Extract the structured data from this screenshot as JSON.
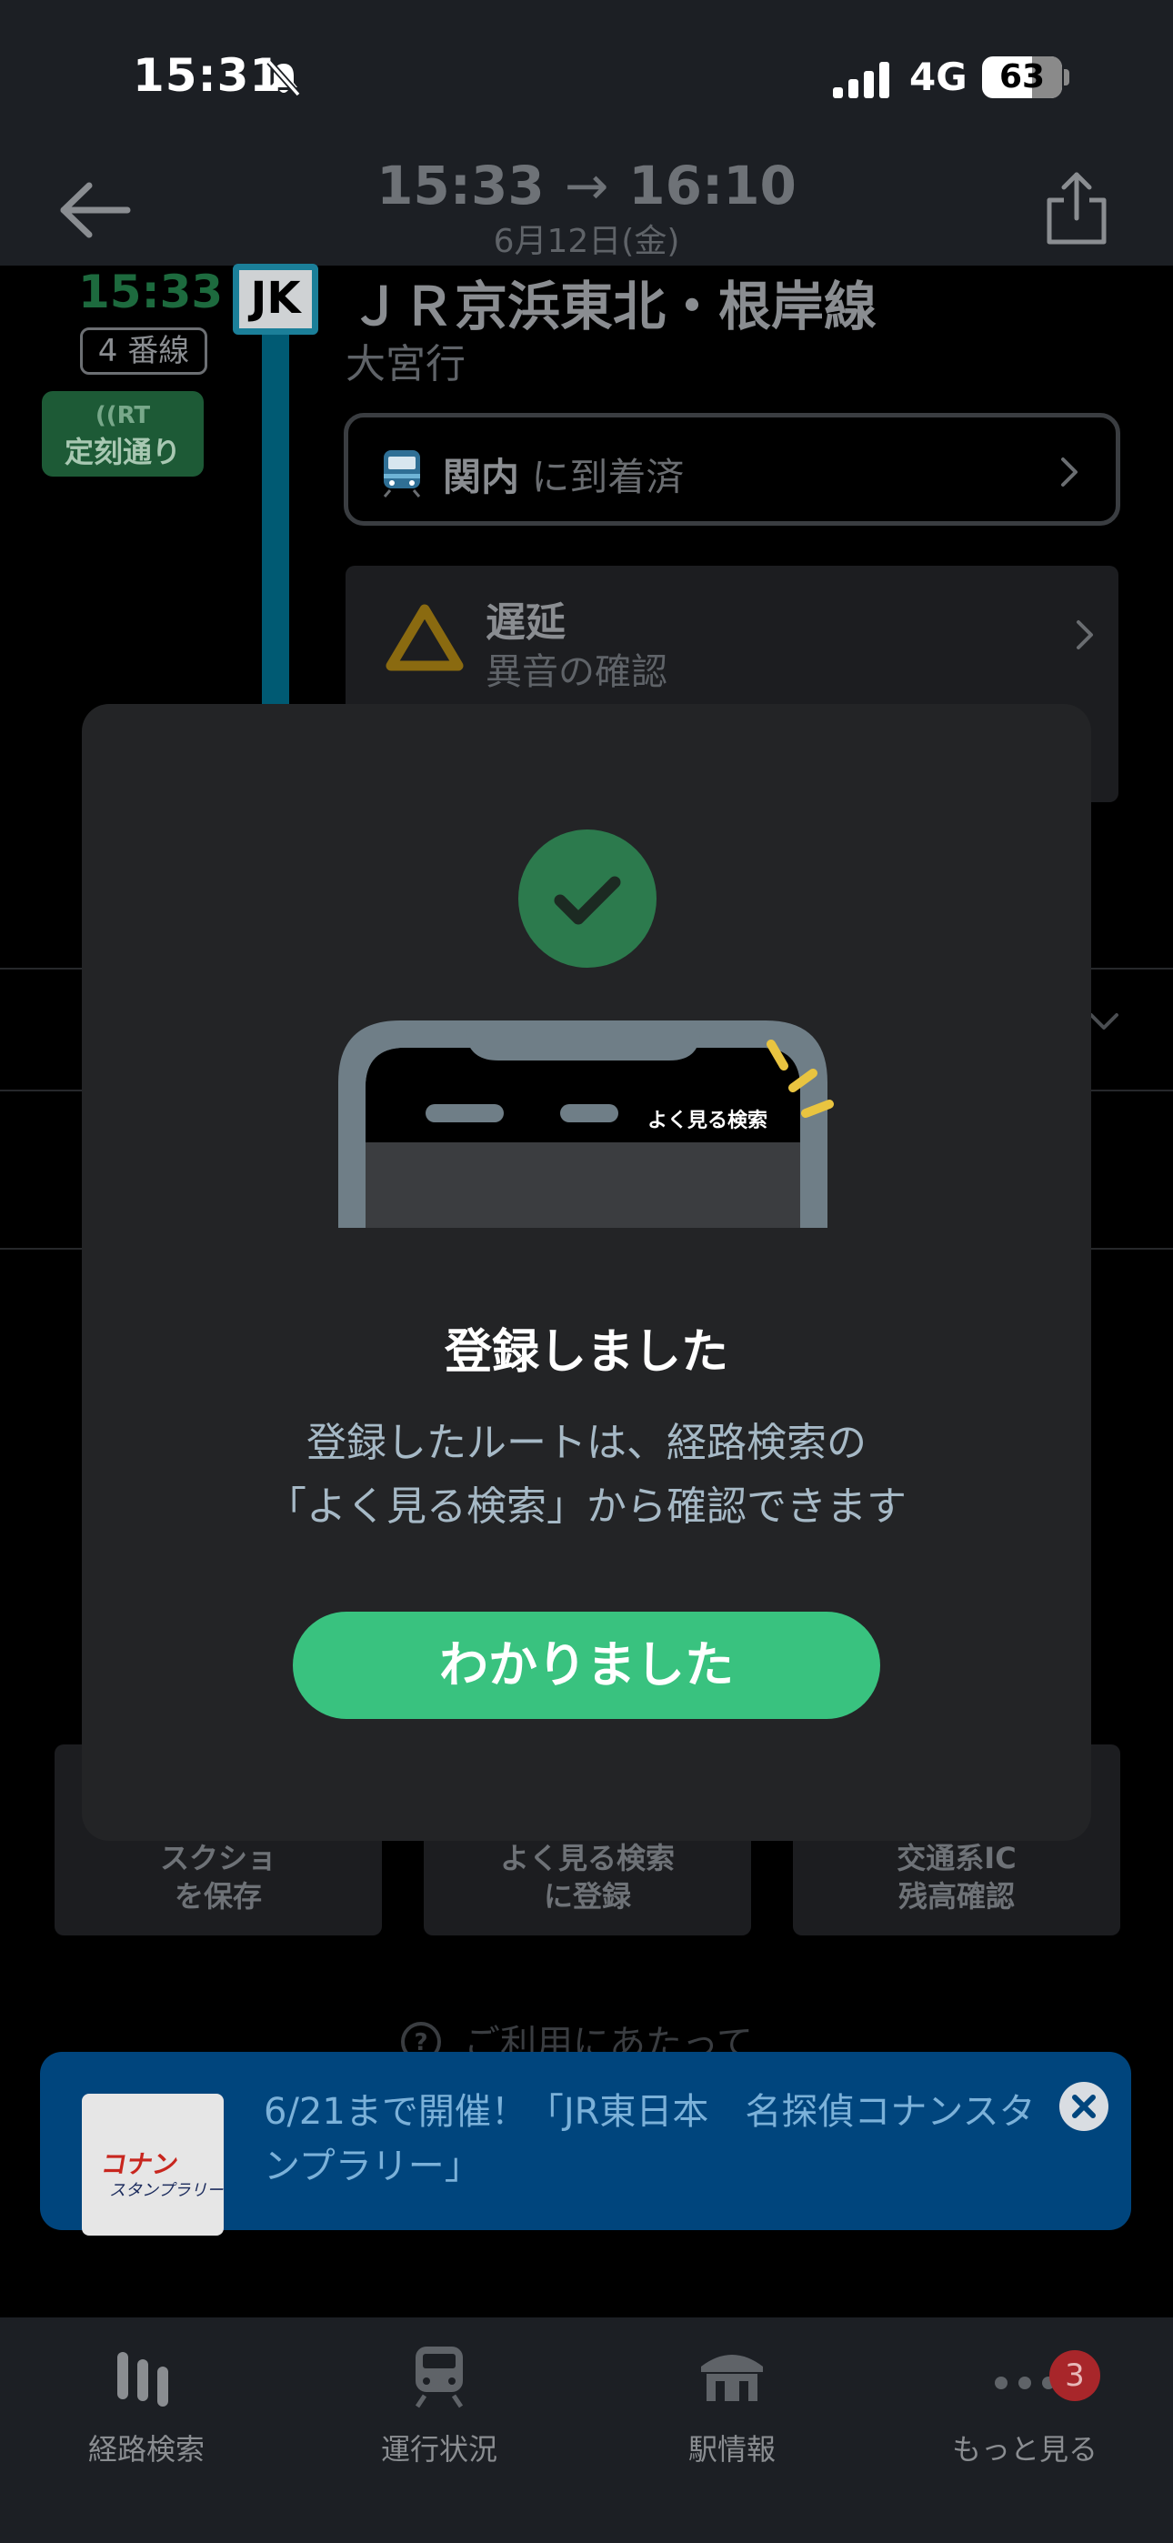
{
  "status_bar": {
    "time": "15:31",
    "network": "4G",
    "battery": "63",
    "battery_level": 0.63
  },
  "header": {
    "depart_time": "15:33",
    "arrow": "→",
    "arrive_time": "16:10",
    "date": "6月12日(金)"
  },
  "route": {
    "depart_time": "15:33",
    "platform": "4 番線",
    "realtime_label": "RT",
    "status": "定刻通り",
    "line_code": "JK",
    "line_name": "ＪＲ京浜東北・根岸線",
    "destination": "大宮行",
    "line_color": "#1b7f99",
    "arrival_card": {
      "station": "関内",
      "text": "に到着済"
    },
    "delay_card": {
      "title": "遅延",
      "subtitle": "異音の確認"
    }
  },
  "actions": [
    {
      "label": "スクショ\nを保存"
    },
    {
      "label": "よく見る検索\nに登録"
    },
    {
      "label": "交通系IC\n残高確認"
    }
  ],
  "usage_link": "ご利用にあたって",
  "banner": {
    "text": "6/21まで開催！「JR東日本　名探偵コナンスタンプラリー」",
    "thumb_logo": "コナン",
    "thumb_sub": "スタンプラリー"
  },
  "modal": {
    "illustration_label": "よく見る検索",
    "title": "登録しました",
    "message": "登録したルートは、経路検索の\n「よく見る検索」から確認できます",
    "button": "わかりました",
    "accent_color": "#39c27f"
  },
  "tabs": [
    {
      "label": "経路検索",
      "icon": "route-search-icon"
    },
    {
      "label": "運行状況",
      "icon": "train-status-icon"
    },
    {
      "label": "駅情報",
      "icon": "station-icon"
    },
    {
      "label": "もっと見る",
      "icon": "more-icon",
      "badge": "3"
    }
  ]
}
